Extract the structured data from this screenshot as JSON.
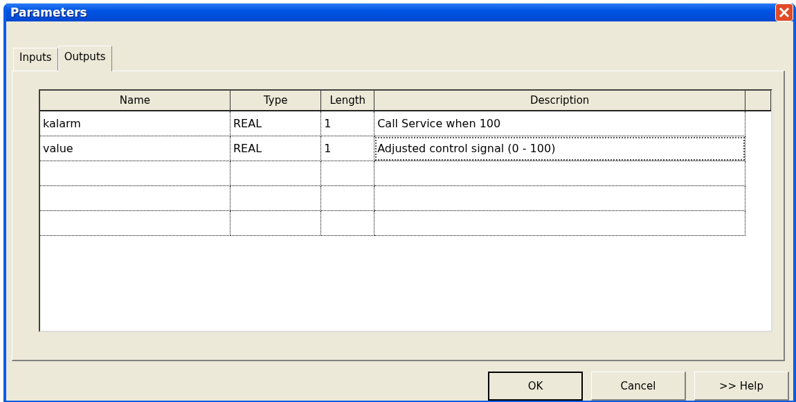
{
  "window": {
    "title": "Parameters"
  },
  "tabs": [
    {
      "label": "Inputs",
      "selected": false
    },
    {
      "label": "Outputs",
      "selected": true
    }
  ],
  "table": {
    "columns": [
      "Name",
      "Type",
      "Length",
      "Description"
    ],
    "rows": [
      {
        "kind": "data",
        "cells": [
          {
            "text": "kalarm",
            "focused": false
          },
          {
            "text": "REAL",
            "focused": false
          },
          {
            "text": "1",
            "focused": false
          },
          {
            "text": "Call Service when 100",
            "focused": false
          }
        ]
      },
      {
        "kind": "data",
        "cells": [
          {
            "text": "value",
            "focused": false
          },
          {
            "text": "REAL",
            "focused": false
          },
          {
            "text": "1",
            "focused": false
          },
          {
            "text": "Adjusted control signal (0 - 100)",
            "focused": true
          }
        ]
      },
      {
        "kind": "blank"
      },
      {
        "kind": "blank"
      },
      {
        "kind": "blank"
      }
    ]
  },
  "buttons": [
    {
      "label": "OK",
      "default": true
    },
    {
      "label": "Cancel",
      "default": false
    },
    {
      "label": ">> Help",
      "default": false
    }
  ]
}
